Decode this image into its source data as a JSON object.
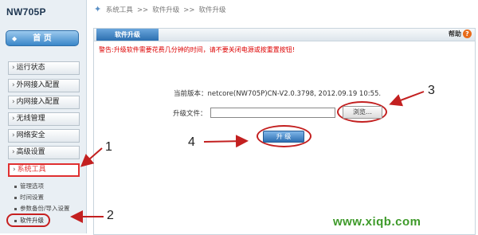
{
  "device": {
    "model": "NW705P"
  },
  "sidebar": {
    "home_label": "首 页",
    "items": [
      {
        "label": "运行状态"
      },
      {
        "label": "外网接入配置"
      },
      {
        "label": "内网接入配置"
      },
      {
        "label": "无线管理"
      },
      {
        "label": "网络安全"
      },
      {
        "label": "高级设置"
      },
      {
        "label": "系统工具"
      }
    ],
    "subitems": [
      {
        "label": "管理选项"
      },
      {
        "label": "时间设置"
      },
      {
        "label": "参数备份/导入设置"
      },
      {
        "label": "软件升级"
      }
    ]
  },
  "breadcrumb": {
    "root": "系统工具",
    "parent": "软件升级",
    "current": "软件升级",
    "separator": ">>"
  },
  "panel": {
    "tab_label": "软件升级",
    "help_label": "帮助",
    "help_icon": "?",
    "warning": "警告:升级软件需要花费几分钟的时间，请不要关闭电源或按重置按钮!",
    "version_label": "当前版本：",
    "version_value": "netcore(NW705P)CN-V2.0.3798, 2012.09.19 10:55.",
    "file_label": "升级文件：",
    "browse_label": "浏览…",
    "upgrade_label": "升 级"
  },
  "annotations": {
    "n1": "1",
    "n2": "2",
    "n3": "3",
    "n4": "4"
  },
  "watermark": "www.xiqb.com",
  "colors": {
    "accent": "#2c6fb0",
    "annotation": "#c32020",
    "warning": "#dd0000",
    "watermark": "#3e9a2a"
  },
  "icons": [
    "home-icon",
    "help-icon",
    "star-icon"
  ]
}
